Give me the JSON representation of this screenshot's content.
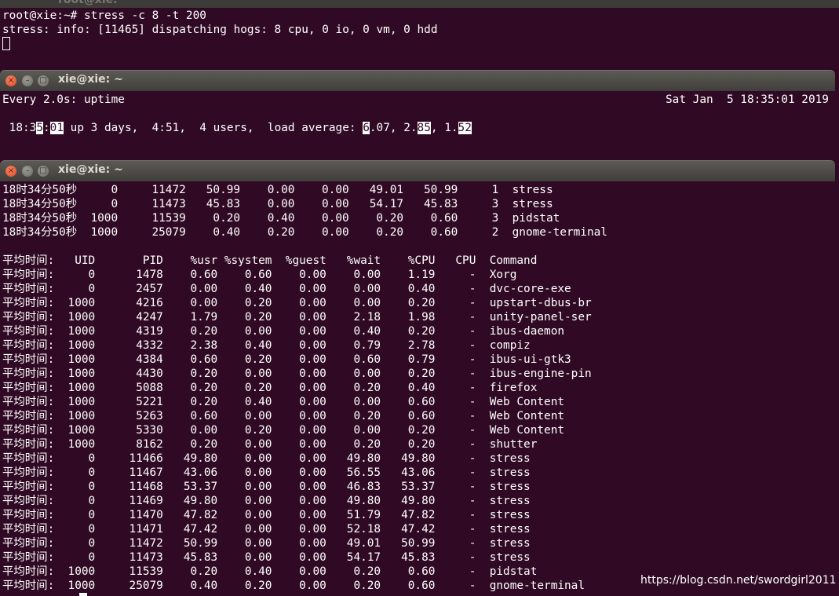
{
  "top_terminal": {
    "title_fragment": "root@xie:",
    "lines": [
      "root@xie:~# stress -c 8 -t 200",
      "stress: info: [11465] dispatching hogs: 8 cpu, 0 io, 0 vm, 0 hdd"
    ]
  },
  "watch_terminal": {
    "title": "xie@xie: ~",
    "header_left": "Every 2.0s: uptime",
    "header_right": "Sat Jan  5 18:35:01 2019",
    "uptime_parts": [
      " 18:3",
      "5",
      ":",
      "01",
      " up 3 days,  4:51,  4 users,  load average: ",
      "6",
      ".07",
      ", 2.",
      "85",
      ", 1.",
      "52"
    ]
  },
  "pidstat_terminal": {
    "title": "xie@xie: ~",
    "sample_rows": [
      "18时34分50秒     0     11472   50.99    0.00    0.00   49.01   50.99     1  stress",
      "18时34分50秒     0     11473   45.83    0.00    0.00   54.17   45.83     3  stress",
      "18时34分50秒  1000     11539    0.20    0.40    0.00    0.20    0.60     3  pidstat",
      "18时34分50秒  1000     25079    0.40    0.20    0.00    0.20    0.60     2  gnome-terminal"
    ],
    "avg_header": "平均时间:   UID       PID    %usr %system  %guest   %wait    %CPU   CPU  Command",
    "avg_rows": [
      "平均时间:     0      1478    0.60    0.60    0.00    0.00    1.19     -  Xorg",
      "平均时间:     0      2457    0.00    0.40    0.00    0.00    0.40     -  dvc-core-exe",
      "平均时间:  1000      4216    0.00    0.20    0.00    0.00    0.20     -  upstart-dbus-br",
      "平均时间:  1000      4247    1.79    0.20    0.00    2.18    1.98     -  unity-panel-ser",
      "平均时间:  1000      4319    0.20    0.00    0.00    0.40    0.20     -  ibus-daemon",
      "平均时间:  1000      4332    2.38    0.40    0.00    0.79    2.78     -  compiz",
      "平均时间:  1000      4384    0.60    0.20    0.00    0.60    0.79     -  ibus-ui-gtk3",
      "平均时间:  1000      4430    0.20    0.00    0.00    0.00    0.20     -  ibus-engine-pin",
      "平均时间:  1000      5088    0.20    0.20    0.00    0.20    0.40     -  firefox",
      "平均时间:  1000      5221    0.20    0.40    0.00    0.00    0.60     -  Web Content",
      "平均时间:  1000      5263    0.60    0.00    0.00    0.20    0.60     -  Web Content",
      "平均时间:  1000      5330    0.00    0.20    0.00    0.00    0.20     -  Web Content",
      "平均时间:  1000      8162    0.20    0.00    0.00    0.20    0.20     -  shutter",
      "平均时间:     0     11466   49.80    0.00    0.00   49.80   49.80     -  stress",
      "平均时间:     0     11467   43.06    0.00    0.00   56.55   43.06     -  stress",
      "平均时间:     0     11468   53.37    0.00    0.00   46.83   53.37     -  stress",
      "平均时间:     0     11469   49.80    0.00    0.00   49.80   49.80     -  stress",
      "平均时间:     0     11470   47.82    0.00    0.00   51.79   47.82     -  stress",
      "平均时间:     0     11471   47.42    0.00    0.00   52.18   47.42     -  stress",
      "平均时间:     0     11472   50.99    0.00    0.00   49.01   50.99     -  stress",
      "平均时间:     0     11473   45.83    0.00    0.00   54.17   45.83     -  stress",
      "平均时间:  1000     11539    0.20    0.40    0.00    0.20    0.60     -  pidstat",
      "平均时间:  1000     25079    0.40    0.20    0.00    0.20    0.60     -  gnome-terminal"
    ]
  },
  "watermark": "https://blog.csdn.net/swordgirl2011",
  "colors": {
    "terminal_bg": "#300a24",
    "text": "#ffffff",
    "titlebar": "#4a4945",
    "close_button": "#e95420"
  }
}
